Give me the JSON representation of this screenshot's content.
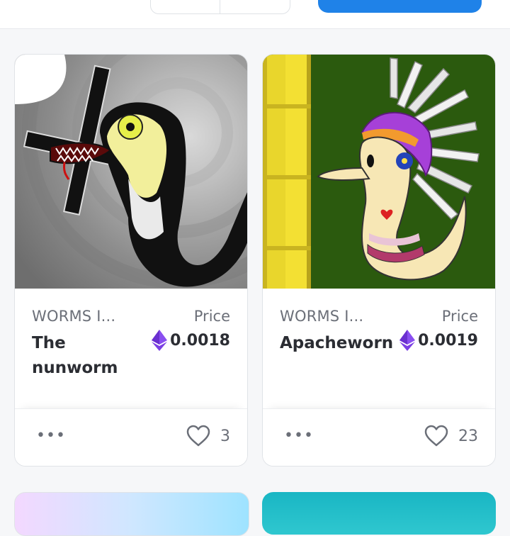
{
  "cards": [
    {
      "collection": "WORMS I...",
      "price_label": "Price",
      "name": "The nunworm",
      "price": "0.0018",
      "likes": "3",
      "more": "•••"
    },
    {
      "collection": "WORMS I...",
      "price_label": "Price",
      "name": "Apacheworn",
      "price": "0.0019",
      "likes": "23",
      "more": "•••"
    }
  ],
  "colors": {
    "primary_button": "#1f82e8",
    "eth_purple": "#7b3fe4",
    "text_muted": "#6b6f78",
    "text_main": "#2b2d33"
  },
  "icons": [
    "ethereum-icon",
    "heart-icon",
    "more-options-icon"
  ]
}
